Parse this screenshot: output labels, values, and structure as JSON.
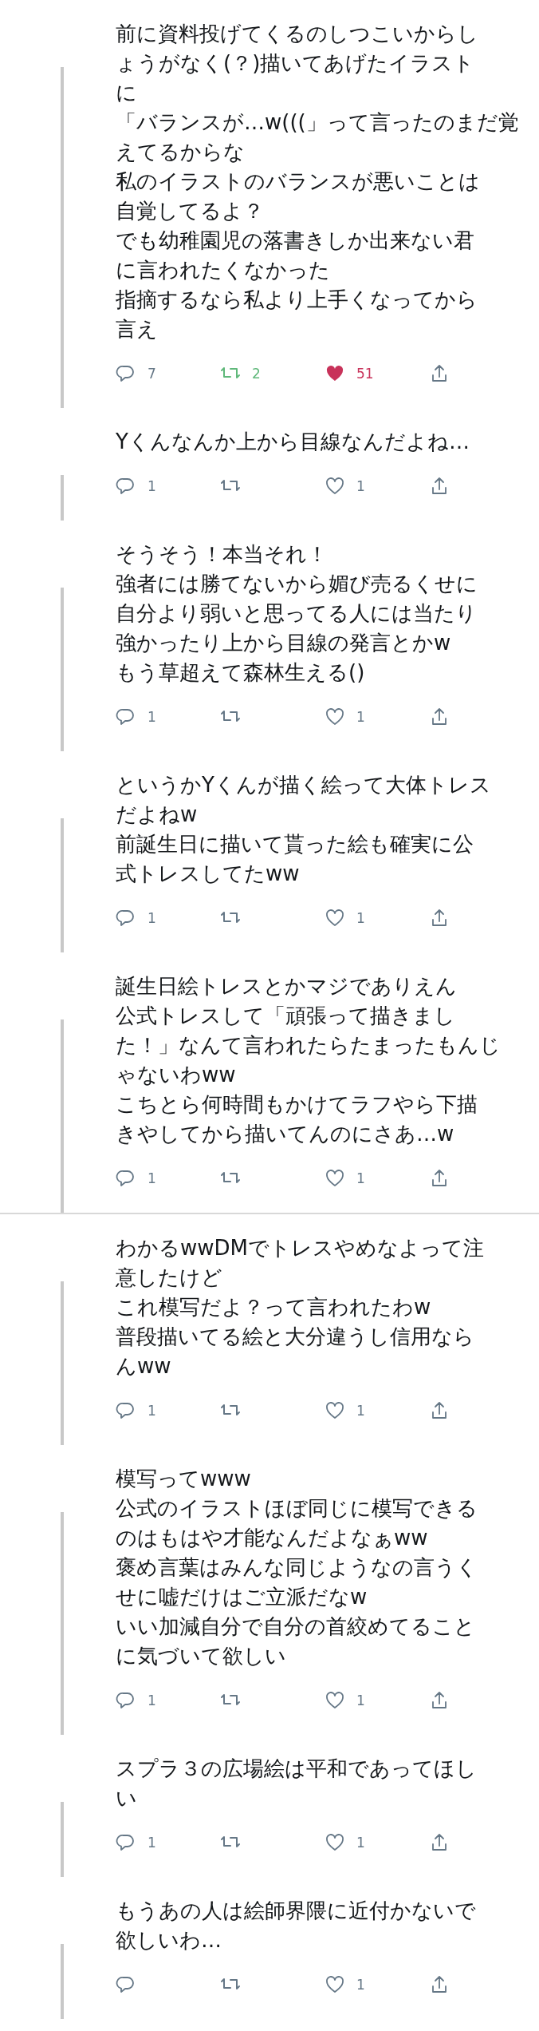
{
  "tweets": [
    {
      "lines": [
        "前に資料投げてくるのしつこいからし",
        "ょうがなく(？)描いてあげたイラスト",
        "に",
        "「バランスが…w(((」って言ったのまだ覚",
        "えてるからな",
        "私のイラストのバランスが悪いことは",
        "自覚してるよ？",
        "でも幼稚園児の落書きしか出来ない君",
        "に言われたくなかった",
        "指摘するなら私より上手くなってから",
        "言え"
      ],
      "replies": "7",
      "retweets": "2",
      "retweeted": true,
      "likes": "51",
      "liked": true
    },
    {
      "lines": [
        "Yくんなんか上から目線なんだよね…"
      ],
      "replies": "1",
      "retweeted": false,
      "likes": "1",
      "liked": false
    },
    {
      "lines": [
        "そうそう！本当それ！",
        "強者には勝てないから媚び売るくせに",
        "自分より弱いと思ってる人には当たり",
        "強かったり上から目線の発言とかw",
        "もう草超えて森林生える()"
      ],
      "replies": "1",
      "retweeted": false,
      "likes": "1",
      "liked": false
    },
    {
      "lines": [
        "というかYくんが描く絵って大体トレス",
        "だよねw",
        "前誕生日に描いて貰った絵も確実に公",
        "式トレスしてたww"
      ],
      "replies": "1",
      "retweeted": false,
      "likes": "1",
      "liked": false
    },
    {
      "lines": [
        "誕生日絵トレスとかマジでありえん",
        "公式トレスして「頑張って描きまし",
        "た！」なんて言われたらたまったもんじ",
        "ゃないわww",
        "こちとら何時間もかけてラフやら下描",
        "きやしてから描いてんのにさあ…w"
      ],
      "replies": "1",
      "retweeted": false,
      "likes": "1",
      "liked": false
    },
    {
      "lines": [
        "わかるwwDMでトレスやめなよって注",
        "意したけど",
        "これ模写だよ？って言われたわw",
        "普段描いてる絵と大分違うし信用なら",
        "んww"
      ],
      "replies": "1",
      "retweeted": false,
      "likes": "1",
      "liked": false
    },
    {
      "lines": [
        "模写ってwww",
        "公式のイラストほぼ同じに模写できる",
        "のはもはや才能なんだよなぁww",
        "褒め言葉はみんな同じようなの言うく",
        "せに嘘だけはご立派だなw",
        "いい加減自分で自分の首絞めてること",
        "に気づいて欲しい"
      ],
      "replies": "1",
      "retweeted": false,
      "likes": "1",
      "liked": false
    },
    {
      "lines": [
        "スプラ３の広場絵は平和であってほし",
        "い"
      ],
      "replies": "1",
      "retweeted": false,
      "likes": "1",
      "liked": false
    },
    {
      "lines": [
        "もうあの人は絵師界隈に近付かないで",
        "欲しいわ…"
      ],
      "retweeted": false,
      "likes": "1",
      "liked": false
    }
  ]
}
